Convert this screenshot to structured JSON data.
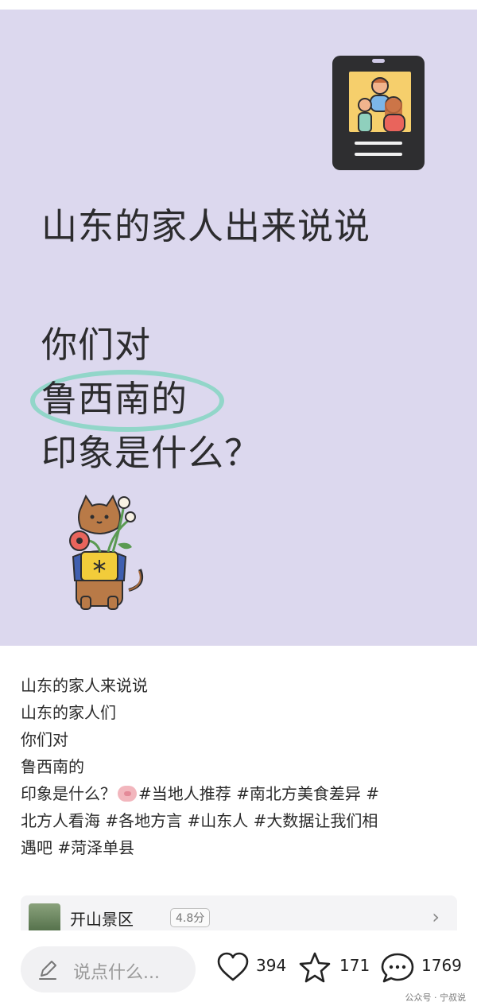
{
  "cover": {
    "headline": "山东的家人出来说说",
    "question_lines": [
      "你们对",
      "鲁西南的",
      "印象是什么？"
    ]
  },
  "caption": {
    "lines": [
      "山东的家人来说说",
      "山东的家人们",
      "你们对",
      "鲁西南的"
    ],
    "last_line_text": "印象是什么？",
    "tags_line_a": "#当地人推荐 #南北方美食差异 #",
    "tags_line_b": "北方人看海 #各地方言 #山东人 #大数据让我们相",
    "tags_line_c": "遇吧 #菏泽单县"
  },
  "poi": {
    "name": "开山景区",
    "rating": "4.8分",
    "chevron_icon": "chevron-right-icon"
  },
  "bottom_bar": {
    "comment_placeholder": "说点什么...",
    "likes": "394",
    "favorites": "171",
    "comments": "1769",
    "watermark": "公众号 · 宁叔说"
  },
  "colors": {
    "cover_background": "#dcd8ee",
    "highlight_ring": "#7fd6bf"
  }
}
